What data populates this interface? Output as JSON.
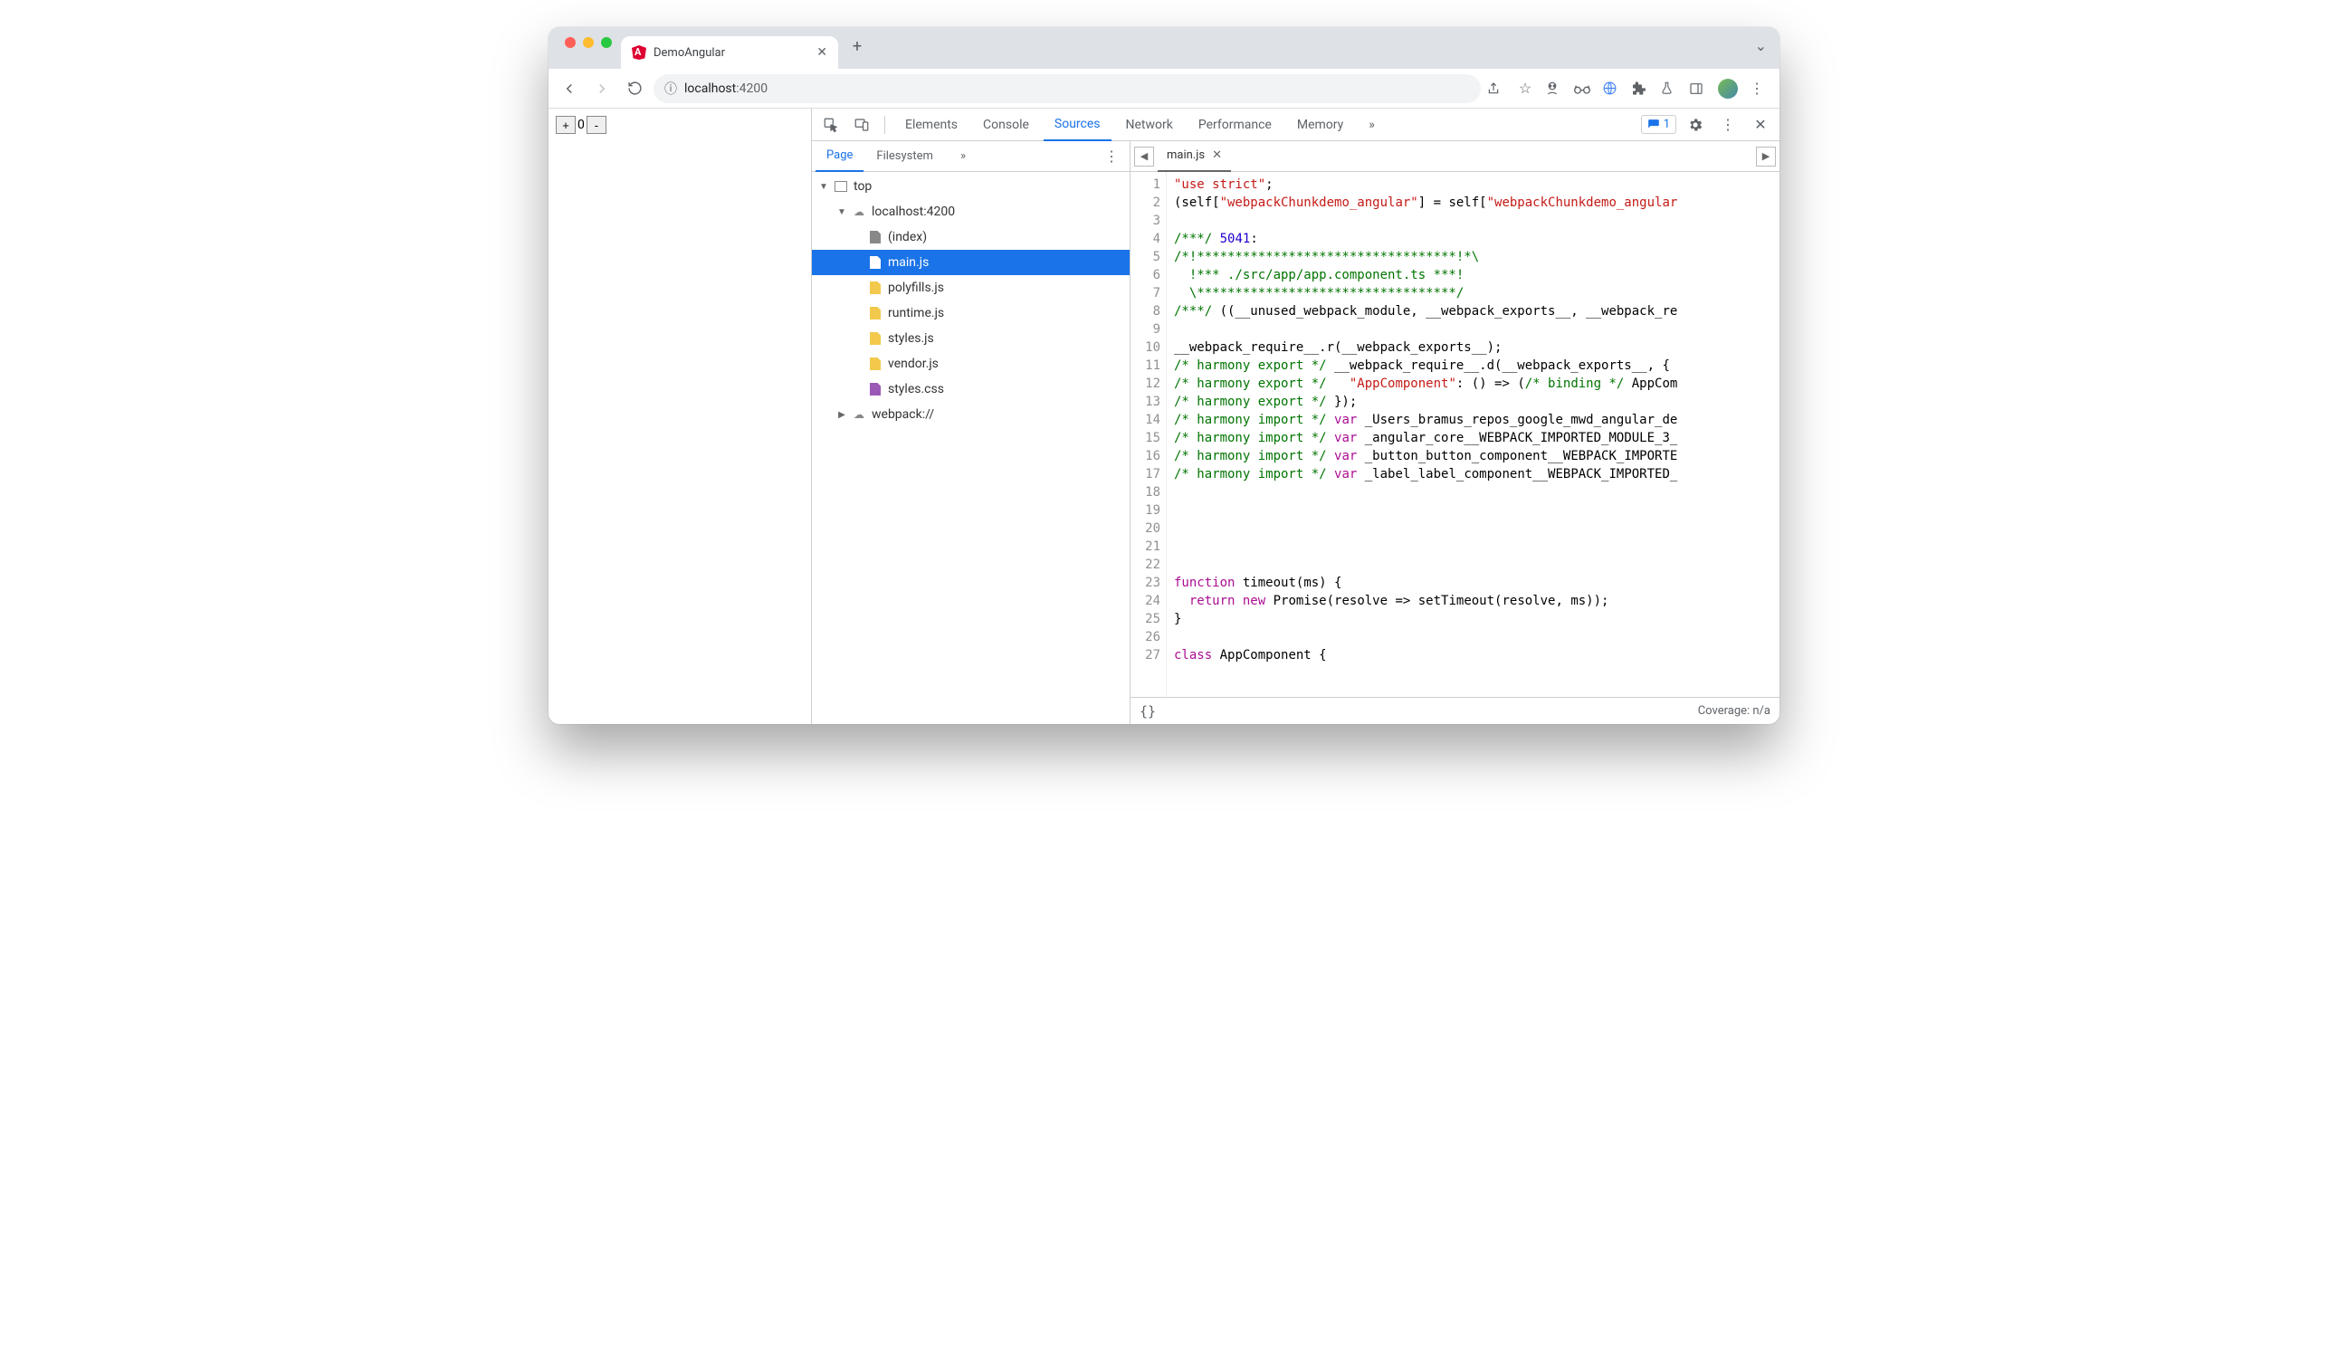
{
  "browser": {
    "tab_title": "DemoAngular",
    "url_host": "localhost",
    "url_port": ":4200"
  },
  "page": {
    "counter_value": "0"
  },
  "devtools": {
    "tabs": [
      "Elements",
      "Console",
      "Sources",
      "Network",
      "Performance",
      "Memory"
    ],
    "active_tab": "Sources",
    "issue_count": "1",
    "navigator": {
      "tabs": [
        "Page",
        "Filesystem"
      ],
      "active": "Page",
      "tree": {
        "top": "top",
        "host": "localhost:4200",
        "files": [
          "(index)",
          "main.js",
          "polyfills.js",
          "runtime.js",
          "styles.js",
          "vendor.js",
          "styles.css"
        ],
        "webpack": "webpack://",
        "selected": "main.js"
      }
    },
    "editor": {
      "open_file": "main.js",
      "lines": [
        {
          "n": 1,
          "html": "<span class='s-str'>\"use strict\"</span>;"
        },
        {
          "n": 2,
          "html": "(self[<span class='s-str'>\"webpackChunkdemo_angular\"</span>] = self[<span class='s-str'>\"webpackChunkdemo_angular</span>"
        },
        {
          "n": 3,
          "html": ""
        },
        {
          "n": 4,
          "html": "<span class='s-com'>/***/</span> <span class='s-num'>5041</span>:"
        },
        {
          "n": 5,
          "html": "<span class='s-com'>/*!**********************************!*\\</span>"
        },
        {
          "n": 6,
          "html": "<span class='s-com'>  !*** ./src/app/app.component.ts ***!</span>"
        },
        {
          "n": 7,
          "html": "<span class='s-com'>  \\**********************************/</span>"
        },
        {
          "n": 8,
          "html": "<span class='s-com'>/***/</span> ((__unused_webpack_module, __webpack_exports__, __webpack_re"
        },
        {
          "n": 9,
          "html": ""
        },
        {
          "n": 10,
          "html": "__webpack_require__.r(__webpack_exports__);"
        },
        {
          "n": 11,
          "html": "<span class='s-com'>/* harmony export */</span> __webpack_require__.d(__webpack_exports__, {"
        },
        {
          "n": 12,
          "html": "<span class='s-com'>/* harmony export */</span>   <span class='s-str'>\"AppComponent\"</span>: () =&gt; (<span class='s-com'>/* binding */</span> AppCom"
        },
        {
          "n": 13,
          "html": "<span class='s-com'>/* harmony export */</span> });"
        },
        {
          "n": 14,
          "html": "<span class='s-com'>/* harmony import */</span> <span class='s-kw'>var</span> _Users_bramus_repos_google_mwd_angular_de"
        },
        {
          "n": 15,
          "html": "<span class='s-com'>/* harmony import */</span> <span class='s-kw'>var</span> _angular_core__WEBPACK_IMPORTED_MODULE_3_"
        },
        {
          "n": 16,
          "html": "<span class='s-com'>/* harmony import */</span> <span class='s-kw'>var</span> _button_button_component__WEBPACK_IMPORTE"
        },
        {
          "n": 17,
          "html": "<span class='s-com'>/* harmony import */</span> <span class='s-kw'>var</span> _label_label_component__WEBPACK_IMPORTED_"
        },
        {
          "n": 18,
          "html": ""
        },
        {
          "n": 19,
          "html": ""
        },
        {
          "n": 20,
          "html": ""
        },
        {
          "n": 21,
          "html": ""
        },
        {
          "n": 22,
          "html": ""
        },
        {
          "n": 23,
          "html": "<span class='s-kw'>function</span> <span class='s-fn'>timeout</span>(ms) {"
        },
        {
          "n": 24,
          "html": "  <span class='s-kw'>return</span> <span class='s-kw'>new</span> Promise(resolve =&gt; setTimeout(resolve, ms));"
        },
        {
          "n": 25,
          "html": "}"
        },
        {
          "n": 26,
          "html": ""
        },
        {
          "n": 27,
          "html": "<span class='s-kw'>class</span> <span class='s-fn'>AppComponent</span> {"
        }
      ]
    },
    "status": {
      "braces": "{}",
      "coverage": "Coverage: n/a"
    }
  }
}
